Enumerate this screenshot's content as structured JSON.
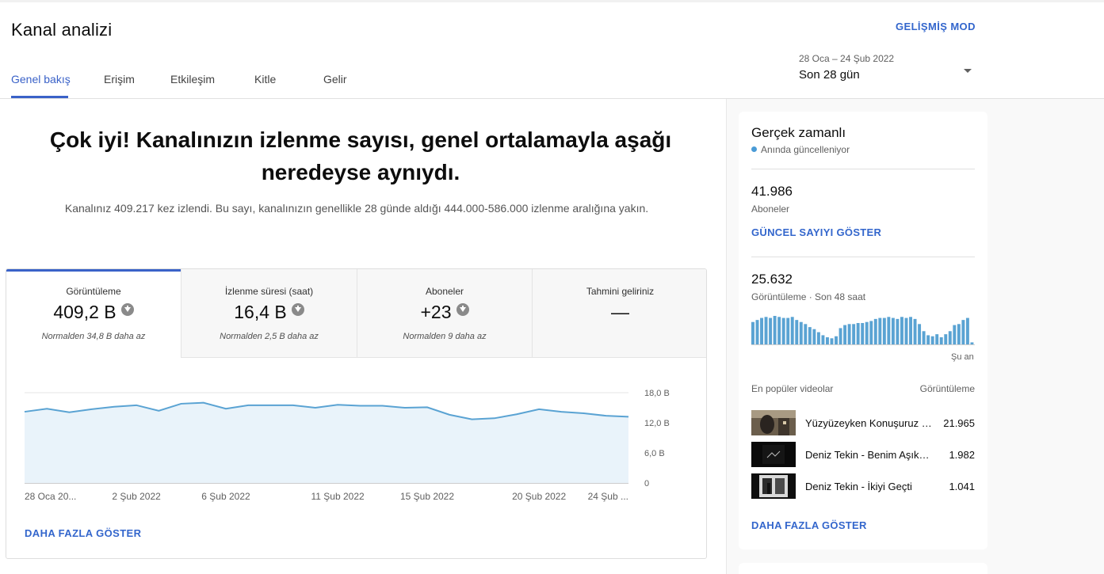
{
  "header": {
    "title": "Kanal analizi",
    "advanced_mode": "GELİŞMİŞ MOD",
    "tabs": [
      {
        "label": "Genel bakış",
        "active": true
      },
      {
        "label": "Erişim",
        "active": false
      },
      {
        "label": "Etkileşim",
        "active": false
      },
      {
        "label": "Kitle",
        "active": false
      },
      {
        "label": "Gelir",
        "active": false
      }
    ],
    "date": {
      "range": "28 Oca – 24 Şub 2022",
      "label": "Son 28 gün"
    }
  },
  "main": {
    "headline": "Çok iyi! Kanalınızın izlenme sayısı, genel ortalamayla aşağı neredeyse aynıydı.",
    "subtext": "Kanalınız 409.217 kez izlendi. Bu sayı, kanalınızın genellikle 28 günde aldığı 444.000-586.000 izlenme aralığına yakın.",
    "metrics": [
      {
        "name": "Görüntüleme",
        "value": "409,2 B",
        "note": "Normalden 34,8 B daha az",
        "trend": "down",
        "active": true
      },
      {
        "name": "İzlenme süresi (saat)",
        "value": "16,4 B",
        "note": "Normalden 2,5 B daha az",
        "trend": "down",
        "active": false
      },
      {
        "name": "Aboneler",
        "value": "+23",
        "note": "Normalden 9 daha az",
        "trend": "down",
        "active": false
      },
      {
        "name": "Tahmini geliriniz",
        "value": "—",
        "note": "",
        "trend": "",
        "active": false
      }
    ],
    "more_link": "DAHA FAZLA GÖSTER"
  },
  "chart_data": {
    "type": "area",
    "x": [
      "28 Oca",
      "29 Oca",
      "30 Oca",
      "31 Oca",
      "1 Şub",
      "2 Şub",
      "3 Şub",
      "4 Şub",
      "5 Şub",
      "6 Şub",
      "7 Şub",
      "8 Şub",
      "9 Şub",
      "10 Şub",
      "11 Şub",
      "12 Şub",
      "13 Şub",
      "14 Şub",
      "15 Şub",
      "16 Şub",
      "17 Şub",
      "18 Şub",
      "19 Şub",
      "20 Şub",
      "21 Şub",
      "22 Şub",
      "23 Şub",
      "24 Şub"
    ],
    "values": [
      14200,
      14800,
      14100,
      14700,
      15200,
      15500,
      14400,
      15800,
      16000,
      14800,
      15500,
      15500,
      15500,
      15000,
      15600,
      15400,
      15400,
      15000,
      15100,
      13600,
      12700,
      12900,
      13700,
      14700,
      14200,
      13900,
      13400,
      13200
    ],
    "x_tick_labels": [
      "28 Oca 20...",
      "2 Şub 2022",
      "6 Şub 2022",
      "11 Şub 2022",
      "15 Şub 2022",
      "20 Şub 2022",
      "24 Şub ..."
    ],
    "y_tick_labels": [
      "18,0 B",
      "12,0 B",
      "6,0 B",
      "0"
    ],
    "ylim": [
      0,
      18000
    ],
    "grid": true,
    "colors": {
      "line": "#5aa3d3",
      "fill": "#e9f3fa",
      "grid": "#e6e6e6"
    }
  },
  "realtime": {
    "title": "Gerçek zamanlı",
    "live_label": "Anında güncelleniyor",
    "subscribers": {
      "value": "41.986",
      "label": "Aboneler",
      "link": "GÜNCEL SAYIYI GÖSTER"
    },
    "views": {
      "value": "25.632",
      "label": "Görüntüleme · Son 48 saat"
    },
    "bars": [
      22,
      24,
      26,
      27,
      26,
      28,
      27,
      26,
      26,
      27,
      24,
      22,
      20,
      17,
      15,
      12,
      9,
      7,
      6,
      8,
      16,
      19,
      20,
      20,
      21,
      21,
      22,
      23,
      25,
      26,
      26,
      27,
      26,
      25,
      27,
      26,
      27,
      25,
      20,
      13,
      9,
      8,
      10,
      7,
      10,
      13,
      19,
      20,
      24,
      26,
      2
    ],
    "now_label": "Şu an",
    "popular_header": "En popüler videolar",
    "popular_views_header": "Görüntüleme",
    "videos": [
      {
        "title": "Yüzyüzeyken Konuşuruz - Ateşe Düşen Yaprak",
        "views": "21.965"
      },
      {
        "title": "Deniz Tekin - Benim Aşık Olmam Lazım",
        "views": "1.982"
      },
      {
        "title": "Deniz Tekin - İkiyi Geçti",
        "views": "1.041"
      }
    ],
    "more_link": "DAHA FAZLA GÖSTER"
  }
}
